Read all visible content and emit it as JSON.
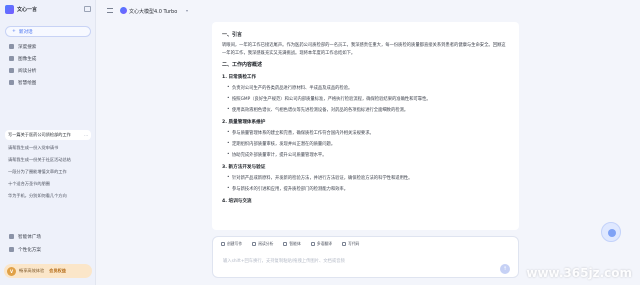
{
  "app": {
    "brand": "文心一言"
  },
  "sidebar": {
    "new_chat": "新对话",
    "nav": [
      {
        "label": "深度搜索",
        "icon": "search-icon"
      },
      {
        "label": "图像生成",
        "icon": "image-icon"
      },
      {
        "label": "阅读分析",
        "icon": "read-icon"
      },
      {
        "label": "智慧绘图",
        "icon": "draw-icon"
      }
    ],
    "history": [
      "写一篇关于医药公司质检部的工作",
      "请帮我生成一份入党申请书",
      "请帮我生成一份关于社区活动总结",
      "一段分为了圈能增值文章的工作",
      "十个适合万圣节的朋圈",
      "华为手机，分别如何看几个方向"
    ],
    "bottom": [
      {
        "label": "智能体广场",
        "icon": "agent-square-icon"
      },
      {
        "label": "个性化方案",
        "icon": "profile-icon"
      }
    ],
    "vip": {
      "badge": "V",
      "text": "畅享高效体验",
      "button": "会员权益"
    }
  },
  "topbar": {
    "model": "文心大模型4.0 Turbo"
  },
  "document": {
    "section1_title": "一、引言",
    "section1_text": "转眼间，一年的工作已接近尾声。作为医药公司质检部的一名员工，我深感责任重大，每一份质检的质量都直接关系到患者的健康与生命安全。回顾这一年的工作，我深感既充实又充满挑战。现将本年度的工作总结如下。",
    "section2_title": "二、工作内容概述",
    "subsections": [
      {
        "title": "1. 日常质检工作",
        "bullets": [
          "负责对公司生产的各类药品进行原材料、半成品及成品的检验。",
          "按照GMP（良好生产规范）和公司内部质量标准，严格执行检验流程，确保检验结果的准确性和可靠性。",
          "使用高效液相色谱仪、气相色谱仪等先进检测设备，对药品的各项指标进行全面细致的检测。"
        ]
      },
      {
        "title": "2. 质量管理体系维护",
        "bullets": [
          "参与质量管理体系的建立和完善，确保质检工作符合国内外相关法规要求。",
          "定期组织内部质量审核，发现并纠正潜在的质量问题。",
          "协助完成外部质量审计，提升公司质量管理水平。"
        ]
      },
      {
        "title": "3. 新方法开发与验证",
        "bullets": [
          "针对新产品或新原料，开发新的检验方法，并进行方法验证，确保检验方法的科学性和适用性。",
          "参与新技术的引进和应用，提升质检部门的检测能力和效率。"
        ]
      },
      {
        "title": "4. 培训与交流",
        "bullets": []
      }
    ]
  },
  "input": {
    "tools": [
      {
        "label": "创建写作",
        "icon": "write-icon"
      },
      {
        "label": "阅读分析",
        "icon": "read-icon"
      },
      {
        "label": "智能体",
        "icon": "agent-icon"
      },
      {
        "label": "多语翻译",
        "icon": "translate-icon"
      },
      {
        "label": "写代码",
        "icon": "code-icon"
      }
    ],
    "placeholder": "输入shift+回车换行，支持复制粘贴/拖拽上传图片、文档或音频"
  },
  "watermark": "www.365jz.com"
}
